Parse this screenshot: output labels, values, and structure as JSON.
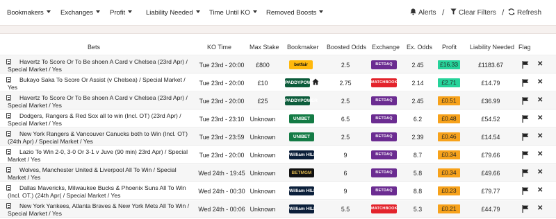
{
  "filters": [
    "Bookmakers",
    "Exchanges",
    "Profit",
    "Liability Needed",
    "Time Until KO",
    "Removed Boosts"
  ],
  "actions": {
    "alerts": "Alerts",
    "clear": "Clear Filters",
    "refresh": "Refresh",
    "separator": "/"
  },
  "columns": [
    "Bets",
    "KO Time",
    "Max Stake",
    "Bookmaker",
    "Boosted Odds",
    "Exchange",
    "Ex. Odds",
    "Profit",
    "Liability Needed",
    "Flag"
  ],
  "close_glyph": "✕",
  "colors": {
    "profit_green": "#26d39a",
    "profit_orange": "#f7a21b",
    "betdaq": "#6b2c91",
    "matchbook": "#e3232b",
    "betfair": "#ffb80c",
    "paddypower": "#0c5c3b",
    "unibet": "#147b45",
    "williamhill": "#0b1f3a",
    "betmgm": "#111111"
  },
  "rows": [
    {
      "bet": "Havertz To Score Or To Be shoen A Card v Chelsea (23rd Apr) / Special Market / Yes",
      "ko": "Tue 23rd - 20:00",
      "stake": "£800",
      "bookmaker": "betfair",
      "bookmaker_logo": "betfair",
      "boosted": "2.5",
      "exchange": "BETDAQ",
      "ex_odds": "2.45",
      "profit": "£16.33",
      "profit_color": "green",
      "liability": "£1183.67",
      "home": false
    },
    {
      "bet": "Bukayo Saka To Score Or Assist (v Chelsea) / Special Market / Yes",
      "ko": "Tue 23rd - 20:00",
      "stake": "£10",
      "bookmaker": "paddypower",
      "bookmaker_logo": "PADDYPOWER",
      "boosted": "2.75",
      "exchange": "MATCHBOOK",
      "ex_odds": "2.14",
      "profit": "£2.71",
      "profit_color": "green",
      "liability": "£14.79",
      "home": true
    },
    {
      "bet": "Havertz To Score Or To Be shoen A Card v Chelsea (23rd Apr) / Special Market / Yes",
      "ko": "Tue 23rd - 20:00",
      "stake": "£25",
      "bookmaker": "paddypower",
      "bookmaker_logo": "PADDYPOWER",
      "boosted": "2.5",
      "exchange": "BETDAQ",
      "ex_odds": "2.45",
      "profit": "£0.51",
      "profit_color": "orange",
      "liability": "£36.99",
      "home": false
    },
    {
      "bet": "Dodgers, Rangers & Red Sox all to win (Incl. OT) (23rd Apr) / Special Market / Yes",
      "ko": "Tue 23rd - 23:10",
      "stake": "Unknown",
      "bookmaker": "unibet",
      "bookmaker_logo": "UNIBET",
      "boosted": "6.5",
      "exchange": "BETDAQ",
      "ex_odds": "6.2",
      "profit": "£0.48",
      "profit_color": "orange",
      "liability": "£54.52",
      "home": false
    },
    {
      "bet": "New York Rangers & Vancouver Canucks both to Win (Incl. OT) (24th Apr) / Special Market / Yes",
      "ko": "Tue 23rd - 23:59",
      "stake": "Unknown",
      "bookmaker": "unibet",
      "bookmaker_logo": "UNIBET",
      "boosted": "2.5",
      "exchange": "BETDAQ",
      "ex_odds": "2.39",
      "profit": "£0.46",
      "profit_color": "orange",
      "liability": "£14.54",
      "home": false
    },
    {
      "bet": "Lazio To Win 2-0, 3-0 Or 3-1 v Juve (90 min) 23rd Apr) / Special Market / Yes",
      "ko": "Tue 23rd - 20:00",
      "stake": "Unknown",
      "bookmaker": "williamhill",
      "bookmaker_logo": "William HILL",
      "boosted": "9",
      "exchange": "BETDAQ",
      "ex_odds": "8.7",
      "profit": "£0.34",
      "profit_color": "orange",
      "liability": "£79.66",
      "home": false
    },
    {
      "bet": "Wolves, Manchester United & Liverpool All To Win / Special Market / Yes",
      "ko": "Wed 24th - 19:45",
      "stake": "Unknown",
      "bookmaker": "betmgm",
      "bookmaker_logo": "BETMGM",
      "boosted": "6",
      "exchange": "BETDAQ",
      "ex_odds": "5.8",
      "profit": "£0.34",
      "profit_color": "orange",
      "liability": "£49.66",
      "home": false
    },
    {
      "bet": "Dallas Mavericks, Milwaukee Bucks & Phoenix Suns All To Win (Incl. OT.) (24th Apr( / Special Market / Yes",
      "ko": "Wed 24th - 00:30",
      "stake": "Unknown",
      "bookmaker": "williamhill",
      "bookmaker_logo": "William HILL",
      "boosted": "9",
      "exchange": "BETDAQ",
      "ex_odds": "8.8",
      "profit": "£0.23",
      "profit_color": "orange",
      "liability": "£79.77",
      "home": false
    },
    {
      "bet": "New York Yankees, Atlanta Braves & New York Mets All To Win / Special Market / Yes",
      "ko": "Wed 24th - 00:06",
      "stake": "Unknown",
      "bookmaker": "williamhill",
      "bookmaker_logo": "William HILL",
      "boosted": "5.5",
      "exchange": "MATCHBOOK",
      "ex_odds": "5.3",
      "profit": "£0.21",
      "profit_color": "orange",
      "liability": "£44.79",
      "home": false
    }
  ]
}
